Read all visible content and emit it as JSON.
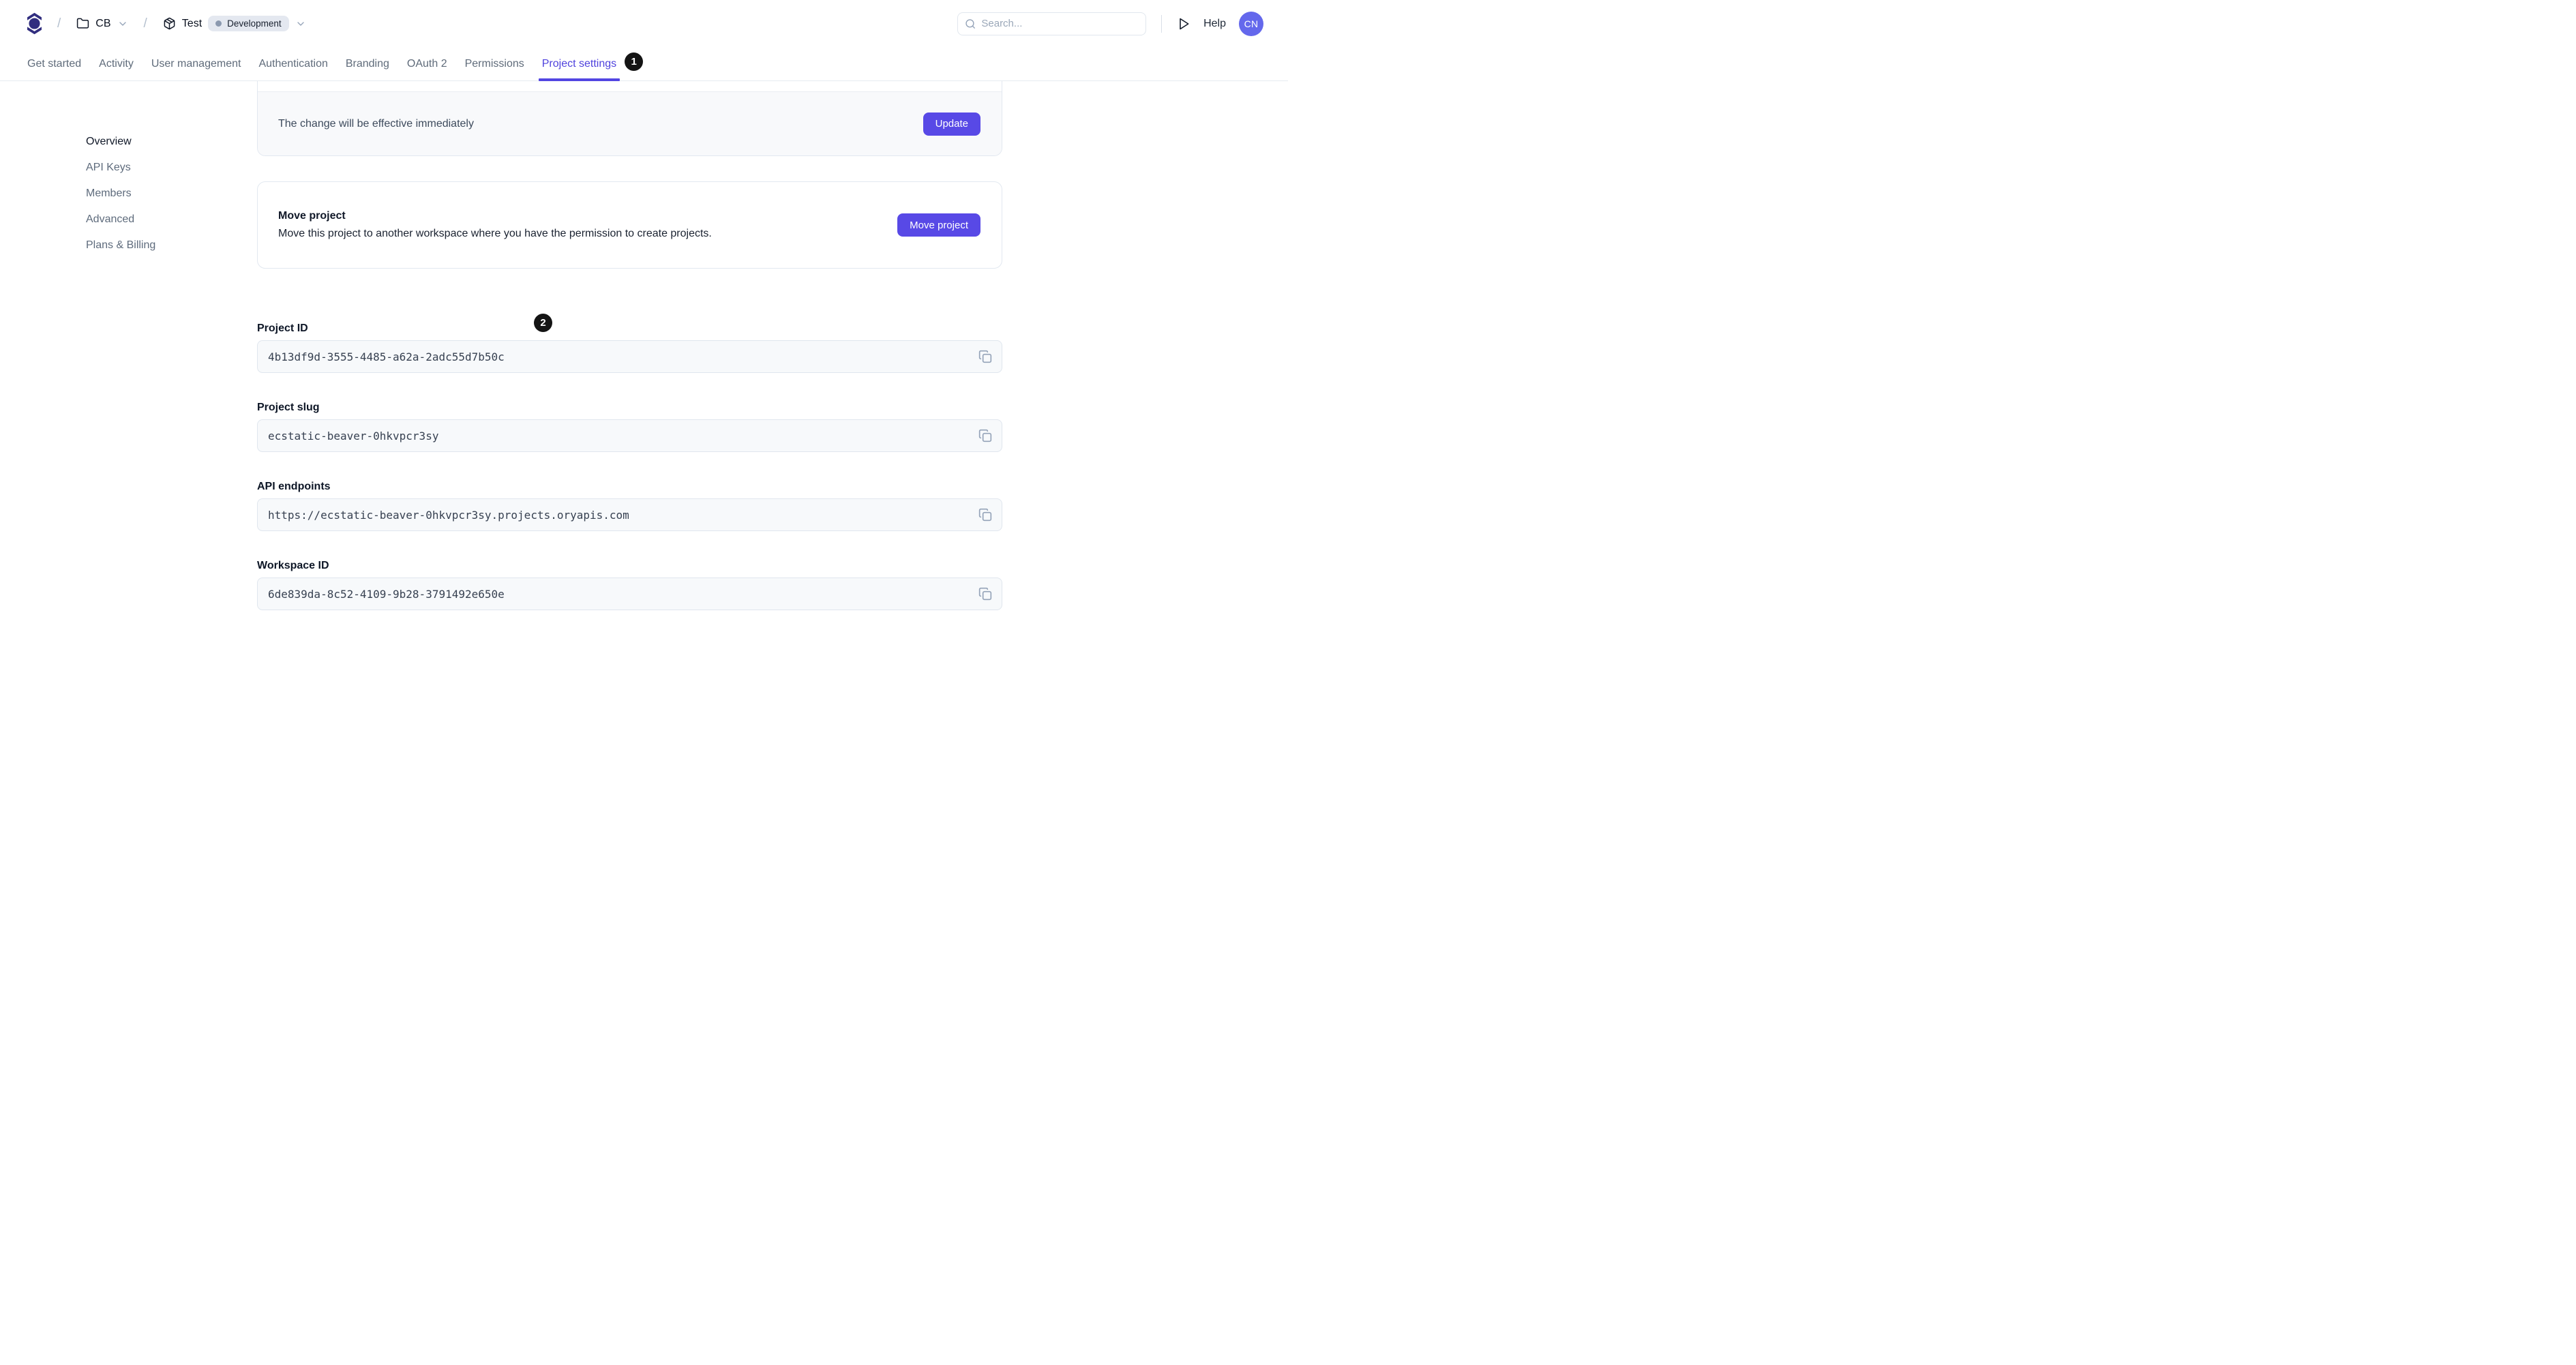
{
  "header": {
    "breadcrumb": {
      "separator": "/",
      "workspace_label": "CB",
      "project_label": "Test",
      "environment_badge": "Development"
    },
    "search": {
      "placeholder": "Search..."
    },
    "help_label": "Help",
    "avatar_initials": "CN"
  },
  "tabs": {
    "items": [
      "Get started",
      "Activity",
      "User management",
      "Authentication",
      "Branding",
      "OAuth 2",
      "Permissions",
      "Project settings"
    ],
    "active": "Project settings",
    "annotation_badge": "1"
  },
  "sidebar": {
    "items": [
      "Overview",
      "API Keys",
      "Members",
      "Advanced",
      "Plans & Billing"
    ],
    "active": "Overview"
  },
  "update_card": {
    "message": "The change will be effective immediately",
    "button_label": "Update"
  },
  "move_card": {
    "title": "Move project",
    "description": "Move this project to another workspace where you have the permission to create projects.",
    "button_label": "Move project"
  },
  "fields": [
    {
      "label": "Project ID",
      "value": "4b13df9d-3555-4485-a62a-2adc55d7b50c",
      "annotation_badge": "2"
    },
    {
      "label": "Project slug",
      "value": "ecstatic-beaver-0hkvpcr3sy"
    },
    {
      "label": "API endpoints",
      "value": "https://ecstatic-beaver-0hkvpcr3sy.projects.oryapis.com"
    },
    {
      "label": "Workspace ID",
      "value": "6de839da-8c52-4109-9b28-3791492e650e"
    }
  ],
  "colors": {
    "brand_indigo": "#5849e6",
    "active_tab": "#4f42dd",
    "logo_navy": "#312e7f",
    "avatar_bg": "#6468ec",
    "annotation_bg": "#141414",
    "env_badge_bg": "#e4e8f0",
    "env_dot": "#8b99af",
    "input_bg": "#f7f9fb",
    "card_footer_bg": "#f8f9fb",
    "border": "#e2e8f0"
  }
}
